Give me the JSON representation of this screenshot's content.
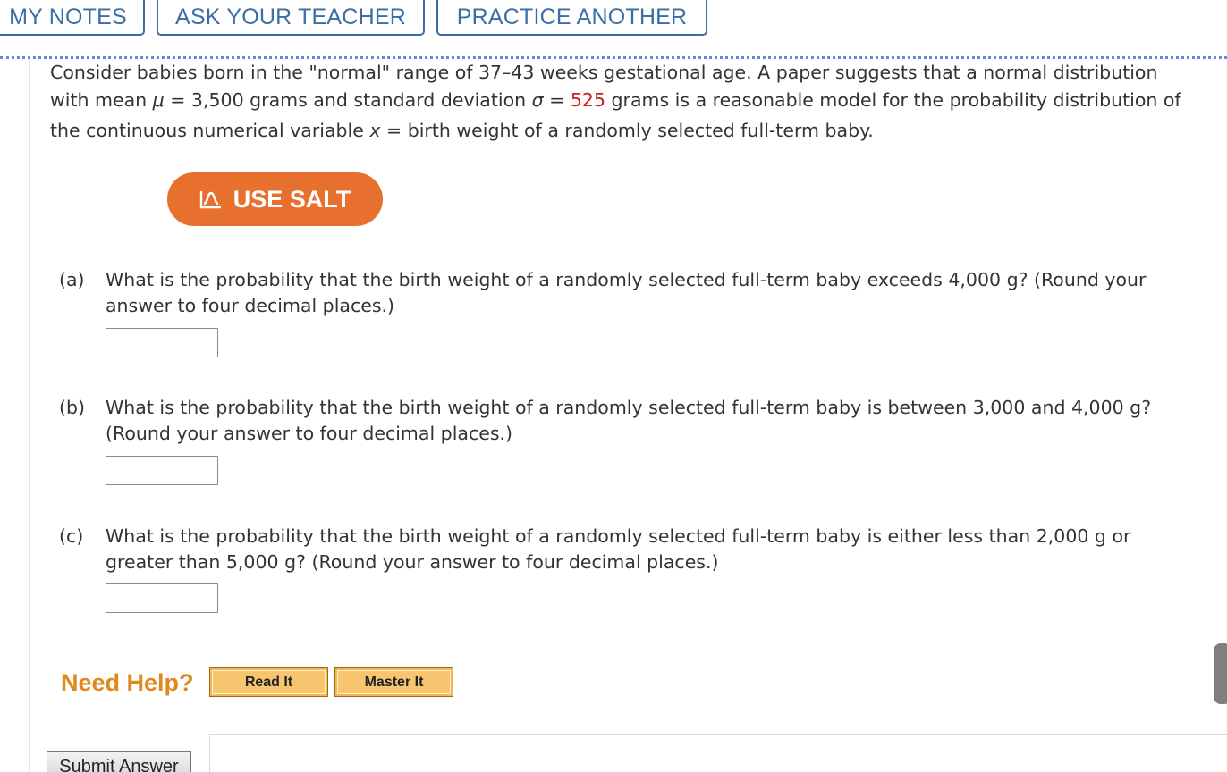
{
  "top_buttons": {
    "my_notes": "MY NOTES",
    "ask_teacher": "ASK YOUR TEACHER",
    "practice_another": "PRACTICE ANOTHER"
  },
  "problem": {
    "line1": "Consider babies born in the \"normal\" range of 37–43 weeks gestational age. A paper suggests that a normal distribution",
    "line2_a": "with mean ",
    "mu_symbol": "μ",
    "line2_b": " = 3,500 grams and standard deviation ",
    "sigma_symbol": "σ",
    "line2_c": " = ",
    "sigma_value": "525",
    "line2_d": " grams is a reasonable model for the probability distribution of",
    "line3_a": "the continuous numerical variable ",
    "x_symbol": "x",
    "line3_b": " = birth weight of a randomly selected full-term baby."
  },
  "salt": {
    "label": "USE SALT"
  },
  "questions": [
    {
      "label": "(a)",
      "line1": "What is the probability that the birth weight of a randomly selected full-term baby exceeds 4,000 g? (Round your",
      "line2": "answer to four decimal places.)",
      "answer": ""
    },
    {
      "label": "(b)",
      "line1": "What is the probability that the birth weight of a randomly selected full-term baby is between 3,000 and 4,000 g?",
      "line2": "(Round your answer to four decimal places.)",
      "answer": ""
    },
    {
      "label": "(c)",
      "line1": "What is the probability that the birth weight of a randomly selected full-term baby is either less than 2,000 g or",
      "line2": "greater than 5,000 g? (Round your answer to four decimal places.)",
      "answer": ""
    }
  ],
  "help": {
    "need_help": "Need Help?",
    "read_it": "Read It",
    "master_it": "Master It"
  },
  "submit": {
    "label": "Submit Answer"
  },
  "colors": {
    "accent_blue": "#3a6ea5",
    "salt_orange": "#e8702e",
    "highlight_red": "#c81e1e",
    "help_orange": "#e08a1e"
  }
}
